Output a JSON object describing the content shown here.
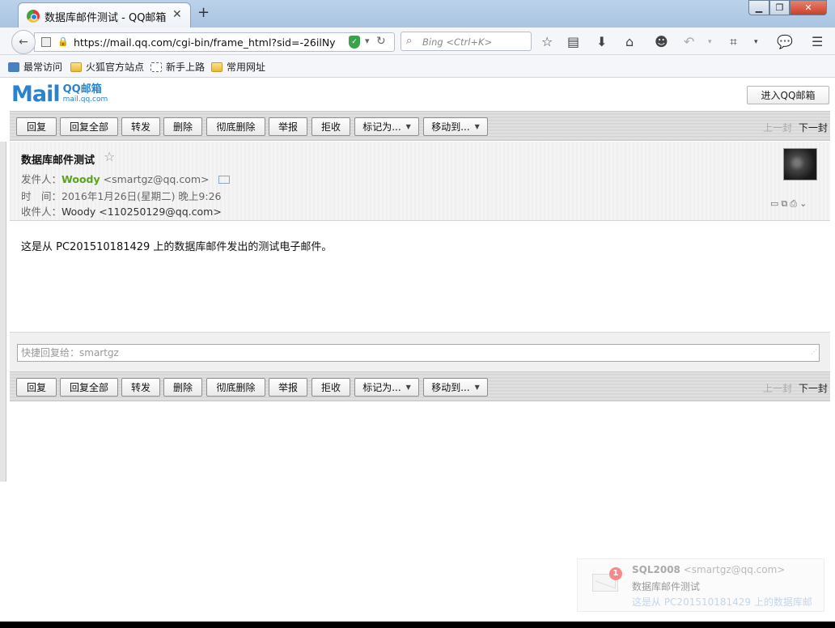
{
  "browser": {
    "tab_title": "数据库邮件测试 - QQ邮箱",
    "url": "https://mail.qq.com/cgi-bin/frame_html?sid=-26ilNy",
    "search_placeholder": "Bing <Ctrl+K>",
    "bookmarks": [
      "最常访问",
      "火狐官方站点",
      "新手上路",
      "常用网址"
    ]
  },
  "mailbox": {
    "logo_text": "Mail",
    "logo_brand": "QQ邮箱",
    "logo_domain": "mail.qq.com",
    "enter_button": "进入QQ邮箱"
  },
  "toolbar": {
    "reply": "回复",
    "reply_all": "回复全部",
    "forward": "转发",
    "delete": "删除",
    "delete_permanently": "彻底删除",
    "report": "举报",
    "reject": "拒收",
    "mark_as": "标记为...",
    "move_to": "移动到...",
    "prev": "上一封",
    "next": "下一封"
  },
  "email": {
    "subject": "数据库邮件测试",
    "from_label": "发件人：",
    "from_name": "Woody",
    "from_email": "<smartgz@qq.com>",
    "time_label": "时　间：",
    "time_value": "2016年1月26日(星期二) 晚上9:26",
    "to_label": "收件人：",
    "to_value": "Woody <110250129@qq.com>",
    "body": "这是从 PC201510181429 上的数据库邮件发出的测试电子邮件。"
  },
  "quick_reply": {
    "placeholder": "快捷回复给：smartgz"
  },
  "notification": {
    "badge": "1",
    "from_name": "SQL2008",
    "from_email": "<smartgz@qq.com>",
    "subject": "数据库邮件测试",
    "preview": "这是从 PC201510181429 上的数据库邮"
  }
}
